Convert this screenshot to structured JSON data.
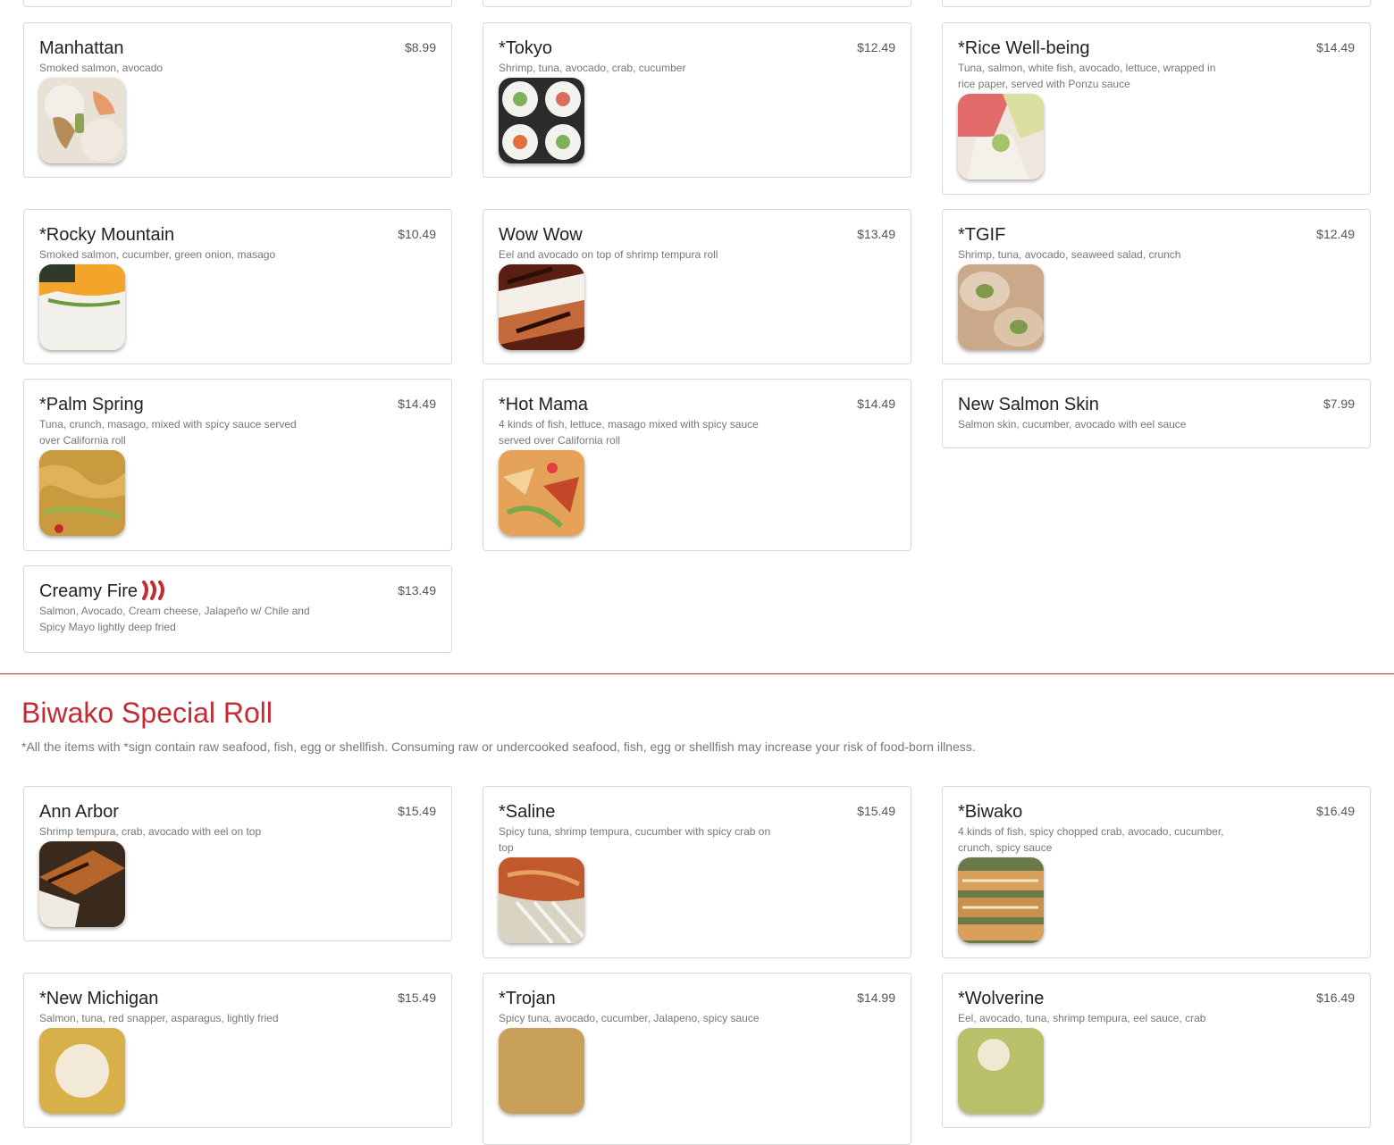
{
  "section_prev": {
    "items": [
      {
        "name": "Manhattan",
        "price": "$8.99",
        "desc": "Smoked salmon, avocado",
        "photo": "food-photo"
      },
      {
        "name": "*Tokyo",
        "price": "$12.49",
        "desc": "Shrimp, tuna, avocado, crab, cucumber",
        "photo": "food-photo"
      },
      {
        "name": "*Rice Well-being",
        "price": "$14.49",
        "desc": "Tuna, salmon, white fish, avocado, lettuce, wrapped in rice paper, served with Ponzu sauce",
        "photo": "food-photo"
      },
      {
        "name": "*Rocky Mountain",
        "price": "$10.49",
        "desc": "Smoked salmon, cucumber, green onion, masago",
        "photo": "food-photo"
      },
      {
        "name": "Wow Wow",
        "price": "$13.49",
        "desc": "Eel and avocado on top of shrimp tempura roll",
        "photo": "food-photo"
      },
      {
        "name": "*TGIF",
        "price": "$12.49",
        "desc": "Shrimp, tuna, avocado, seaweed salad, crunch",
        "photo": "food-photo"
      },
      {
        "name": "*Palm Spring",
        "price": "$14.49",
        "desc": "Tuna, crunch, masago, mixed with spicy sauce served over California roll",
        "photo": "food-photo"
      },
      {
        "name": "*Hot Mama",
        "price": "$14.49",
        "desc": "4 kinds of fish, lettuce, masago mixed with spicy sauce served over California roll",
        "photo": "food-photo"
      },
      {
        "name": "New Salmon Skin",
        "price": "$7.99",
        "desc": "Salmon skin, cucumber, avocado with eel sauce"
      },
      {
        "name": "Creamy Fire",
        "price": "$13.49",
        "desc": "Salmon, Avocado, Cream cheese, Jalapeño w/ Chile and Spicy Mayo lightly deep fried",
        "icon": "chili-pepper-icon"
      }
    ]
  },
  "section": {
    "title": "Biwako Special Roll",
    "note": "*All the items with *sign contain raw seafood, fish, egg or shellfish. Consuming raw or undercooked seafood, fish, egg or shellfish may increase your risk of food-born illness.",
    "items": [
      {
        "name": "Ann Arbor",
        "price": "$15.49",
        "desc": "Shrimp tempura, crab, avocado with eel on top"
      },
      {
        "name": "*Saline",
        "price": "$15.49",
        "desc": "Spicy tuna, shrimp tempura, cucumber with spicy crab on top"
      },
      {
        "name": "*Biwako",
        "price": "$16.49",
        "desc": "4 kinds of fish, spicy chopped crab, avocado, cucumber, crunch, spicy sauce"
      },
      {
        "name": "*New Michigan",
        "price": "$15.49",
        "desc": "Salmon, tuna, red snapper, asparagus, lightly fried"
      },
      {
        "name": "*Trojan",
        "price": "$14.99",
        "desc": "Spicy tuna, avocado, cucumber, Jalapeno, spicy sauce"
      },
      {
        "name": "*Wolverine",
        "price": "$16.49",
        "desc": "Eel, avocado, tuna, shrimp tempura, eel sauce, crab"
      }
    ]
  },
  "colors": {
    "accent": "#c62a34",
    "border": "#d9d9d9",
    "muted": "#777777"
  }
}
